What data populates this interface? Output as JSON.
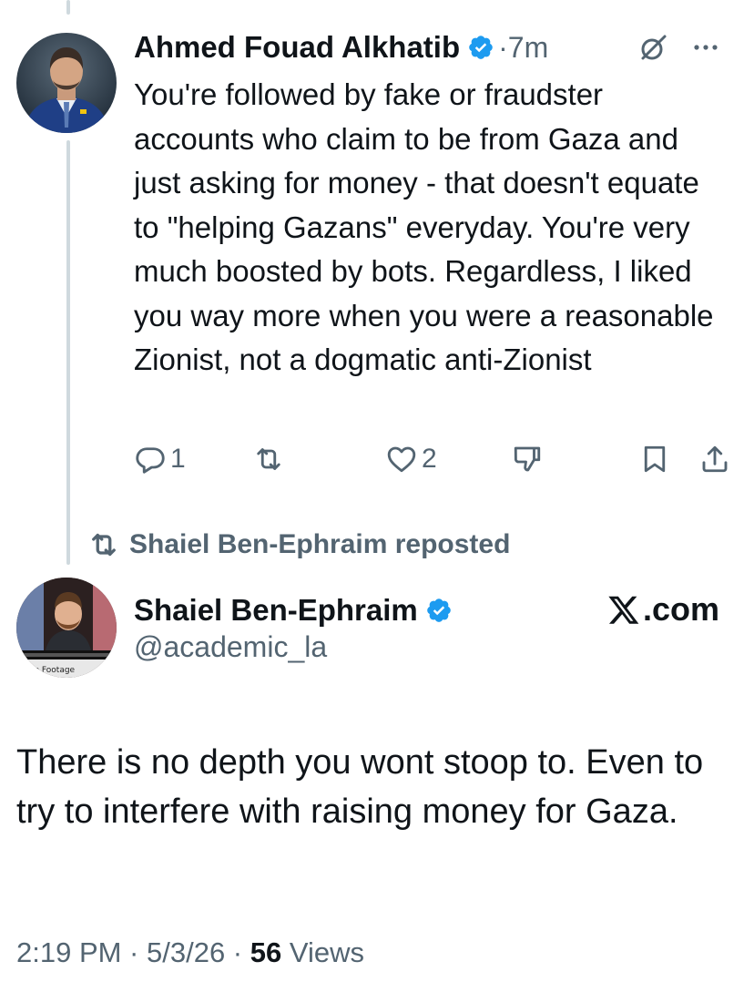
{
  "tweet": {
    "author_name": "Ahmed Fouad Alkhatib",
    "time": "·7m",
    "text": "You're followed by fake or fraudster accounts who claim to be from Gaza and just asking for money - that doesn't equate to \"helping Gazans\" everyday. You're very much boosted by bots. Regardless, I liked you way more when you were a reasonable Zionist, not a dogmatic anti-Zionist",
    "replies": "1",
    "likes": "2"
  },
  "repost": {
    "label": "Shaiel Ben-Ephraim reposted"
  },
  "quoted": {
    "author_name": "Shaiel Ben-Ephraim",
    "handle": "@academic_la",
    "source": ".com",
    "text": "There is no depth you wont stoop to. Even to try to interfere with raising money for Gaza."
  },
  "meta": {
    "timestamp": "2:19 PM · 5/3/26 · ",
    "views_count": "56",
    "views_label": " Views"
  },
  "colors": {
    "text": "#0f1419",
    "secondary": "#536471",
    "verified": "#1d9bf0",
    "thread_line": "#cfd9de"
  },
  "icons": [
    "verified-badge-icon",
    "grok-icon",
    "more-icon",
    "reply-icon",
    "repost-icon",
    "like-icon",
    "dislike-icon",
    "bookmark-icon",
    "share-icon",
    "x-logo-icon"
  ]
}
